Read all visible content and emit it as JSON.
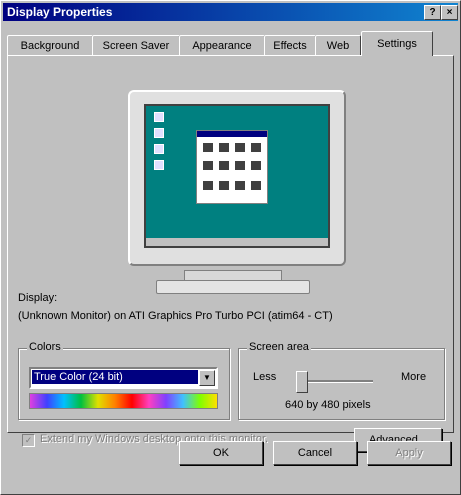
{
  "window": {
    "title": "Display Properties",
    "help_label": "?",
    "close_label": "×"
  },
  "tabs": [
    {
      "label": "Background"
    },
    {
      "label": "Screen Saver"
    },
    {
      "label": "Appearance"
    },
    {
      "label": "Effects"
    },
    {
      "label": "Web"
    },
    {
      "label": "Settings"
    }
  ],
  "active_tab": "Settings",
  "display": {
    "label": "Display:",
    "value": "(Unknown Monitor) on ATI Graphics Pro Turbo PCI (atim64 - CT)"
  },
  "colors": {
    "label": "Colors",
    "selected": "True Color (24 bit)"
  },
  "screen_area": {
    "label": "Screen area",
    "less_label": "Less",
    "more_label": "More",
    "resolution_text": "640 by 480 pixels",
    "slider_level": 0.0
  },
  "extend_checkbox": {
    "label": "Extend my Windows desktop onto this monitor.",
    "checked": true,
    "enabled": false
  },
  "buttons": {
    "advanced_pre": "Ad",
    "advanced_u": "v",
    "advanced_post": "anced...",
    "ok": "OK",
    "cancel": "Cancel",
    "apply": "Apply"
  },
  "icons": [
    "check-icon",
    "dropdown-arrow-icon",
    "help-icon",
    "close-icon"
  ]
}
